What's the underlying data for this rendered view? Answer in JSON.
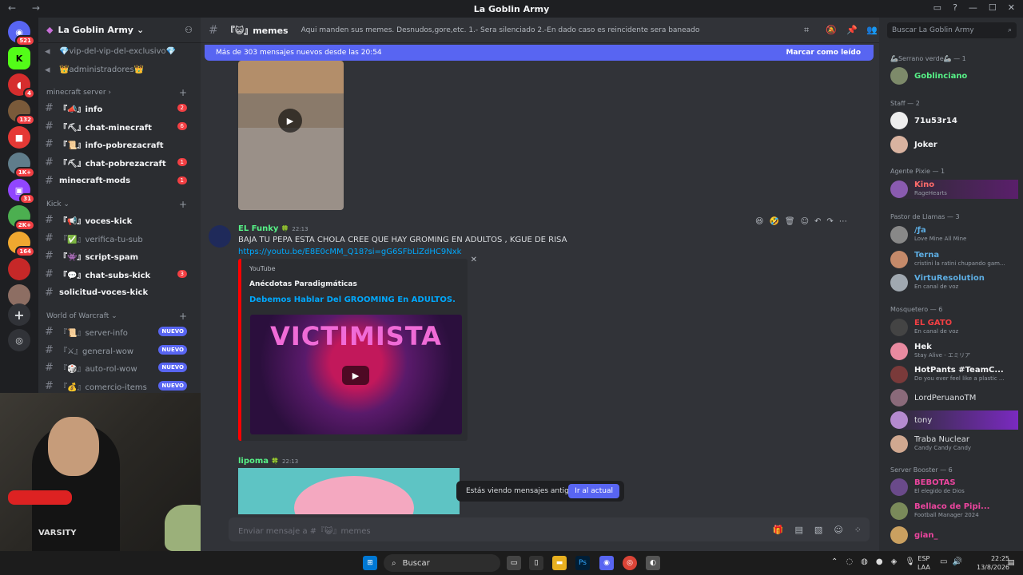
{
  "titlebar": {
    "title": "La Goblin Army"
  },
  "servers": [
    {
      "name": "Discord Home",
      "badge": "521",
      "color": "#5865f2"
    },
    {
      "name": "Kick",
      "badge": "",
      "color": "#53fc18"
    },
    {
      "name": "Server 3",
      "badge": "4",
      "color": "#d62d2d"
    },
    {
      "name": "Server 4",
      "badge": "132",
      "color": "#7a5a3a"
    },
    {
      "name": "Server 5",
      "badge": "",
      "color": "#e53935"
    },
    {
      "name": "Server 6",
      "badge": "1K+",
      "color": "#607d8b"
    },
    {
      "name": "Twitch",
      "badge": "31",
      "color": "#9146ff"
    },
    {
      "name": "Server 8",
      "badge": "2K+",
      "color": "#4caf50"
    },
    {
      "name": "Server 9",
      "badge": "164",
      "color": "#f0a830"
    },
    {
      "name": "Server 10",
      "badge": "",
      "color": "#c62828"
    },
    {
      "name": "Server 11",
      "badge": "",
      "color": "#8d6e63"
    }
  ],
  "sidebar": {
    "server_name": "La Goblin Army",
    "top_channels": [
      "💎vip-del-vip-del-exclusivo💎",
      "👑administradores👑"
    ],
    "categories": [
      {
        "name": "minecraft server",
        "channels": [
          {
            "name": "『📣』info",
            "badge": "2",
            "unread": true
          },
          {
            "name": "『⛏』chat-minecraft",
            "badge": "6",
            "unread": true
          },
          {
            "name": "『📜』info-pobrezacraft",
            "badge": "",
            "unread": true
          },
          {
            "name": "『⛏』chat-pobrezacraft",
            "badge": "1",
            "unread": true
          },
          {
            "name": "minecraft-mods",
            "badge": "1",
            "unread": true
          }
        ]
      },
      {
        "name": "Kick",
        "channels": [
          {
            "name": "『📢』voces-kick",
            "badge": "",
            "unread": true
          },
          {
            "name": "『✅』verifica-tu-sub",
            "badge": "",
            "unread": false
          },
          {
            "name": "『👾』script-spam",
            "badge": "",
            "unread": true
          },
          {
            "name": "『💬』chat-subs-kick",
            "badge": "3",
            "unread": true
          },
          {
            "name": "solicitud-voces-kick",
            "badge": "",
            "unread": true
          }
        ]
      },
      {
        "name": "World of Warcraft",
        "channels": [
          {
            "name": "『📜』server-info",
            "badge": "NUEVO",
            "unread": false
          },
          {
            "name": "『⚔』general-wow",
            "badge": "NUEVO",
            "unread": false
          },
          {
            "name": "『🎲』auto-rol-wow",
            "badge": "NUEVO",
            "unread": false
          },
          {
            "name": "『💰』comercio-items",
            "badge": "NUEVO",
            "unread": false
          }
        ]
      }
    ]
  },
  "channel": {
    "name": "『😺』memes",
    "topic": "Aqui manden sus memes. Desnudos,gore,etc. 1.- Sera silenciado 2.-En dado caso es reincidente sera baneado"
  },
  "banner": {
    "text": "Más de 303 mensajes nuevos desde las 20:54",
    "mark_read": "Marcar como leído"
  },
  "messages": [
    {
      "author": "EL Funky",
      "author_color": "#57f287",
      "time": "22:13",
      "text": "BAJA TU PEPA ESTA CHOLA CREE QUE HAY GROMING EN ADULTOS , KGUE DE RISA",
      "link": "https://youtu.be/E8E0cMM_Q18?si=gG6SFbLiZdHC9Nxk",
      "embed": {
        "provider": "YouTube",
        "author": "Anécdotas Paradigmáticas",
        "title": "Debemos Hablar Del GROOMING En ADULTOS.",
        "thumb_text": "VICTIMISTA"
      }
    },
    {
      "author": "lipoma",
      "author_color": "#57f287",
      "time": "22:13"
    }
  ],
  "toast": {
    "text": "Estás viendo mensajes antiguos",
    "button": "Ir al actual"
  },
  "composer": {
    "placeholder": "Enviar mensaje a #『😺』memes"
  },
  "members": {
    "search_placeholder": "Buscar La Goblin Army",
    "groups": [
      {
        "name": "🦾Serrano verde🦾 — 1",
        "members": [
          {
            "name": "Goblinciano",
            "status": "",
            "color": "#57f287"
          }
        ]
      },
      {
        "name": "Staff — 2",
        "members": [
          {
            "name": "71u53r14",
            "status": "",
            "color": "#f2f3f5"
          },
          {
            "name": "Joker",
            "status": "",
            "color": "#f2f3f5"
          }
        ]
      },
      {
        "name": "Agente Pixie — 1",
        "members": [
          {
            "name": "Kino",
            "status": "RageHearts",
            "color": "#ff6b6b"
          }
        ]
      },
      {
        "name": "Pastor de Llamas — 3",
        "members": [
          {
            "name": "/ƒa",
            "status": "Love Mine All Mine",
            "color": "#5dade2"
          },
          {
            "name": "Terna",
            "status": "cristini la ratini chupando gam...",
            "color": "#5dade2"
          },
          {
            "name": "VirtuResolution",
            "status": "En canal de voz",
            "color": "#5dade2"
          }
        ]
      },
      {
        "name": "Mosquetero — 6",
        "members": [
          {
            "name": "EL GATO",
            "status": "En canal de voz",
            "color": "#f23f43"
          },
          {
            "name": "Hek",
            "status": "Stay Alive - エミリア",
            "color": "#f2f3f5"
          },
          {
            "name": "HotPants #TeamC...",
            "status": "Do you ever feel like a plastic ...",
            "color": "#f2f3f5"
          },
          {
            "name": "LordPeruanoTM",
            "status": "",
            "color": "#dbdee1"
          },
          {
            "name": "tony",
            "status": "",
            "color": "#dbdee1"
          },
          {
            "name": "Traba Nuclear",
            "status": "Candy Candy Candy",
            "color": "#dbdee1"
          }
        ]
      },
      {
        "name": "Server Booster — 6",
        "members": [
          {
            "name": "BEBOTAS",
            "status": "El elegido de Dios",
            "color": "#eb459e"
          },
          {
            "name": "Bellaco de Pipi...",
            "status": "Football Manager 2024",
            "color": "#eb459e"
          },
          {
            "name": "gian_",
            "status": "",
            "color": "#eb459e"
          }
        ]
      }
    ]
  },
  "taskbar": {
    "search": "Buscar",
    "lang1": "ESP",
    "lang2": "LAA",
    "time": "22:25",
    "date": "13/8/2026"
  },
  "webcam": {
    "shirt_text": "VARSITY"
  }
}
